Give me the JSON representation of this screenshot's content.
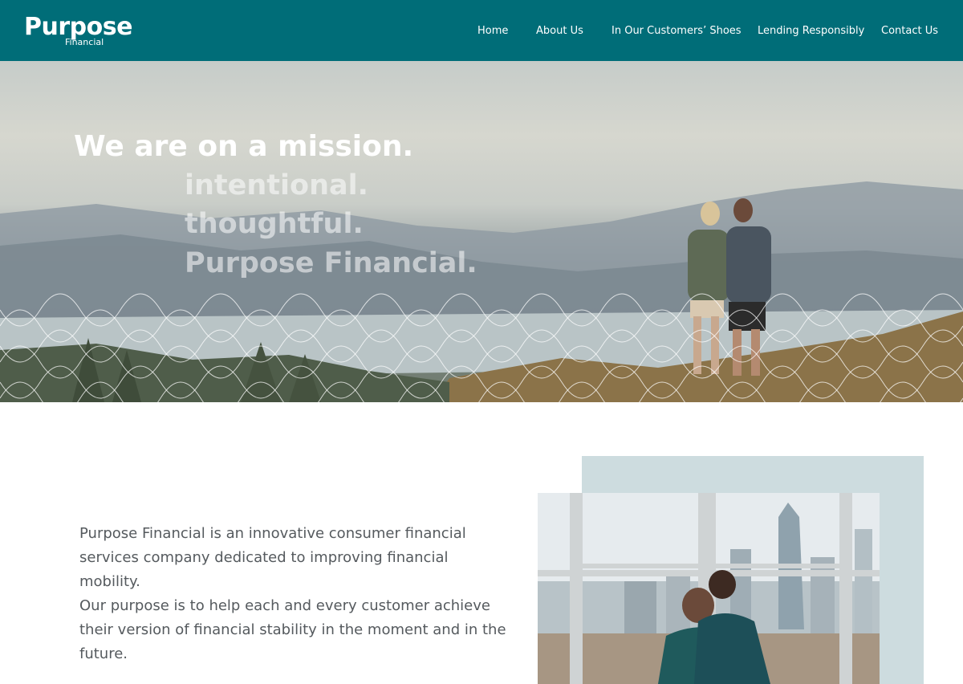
{
  "header": {
    "logo_main": "Purpose",
    "logo_sub": "Financial",
    "nav": [
      {
        "label": "Home"
      },
      {
        "label": "About Us"
      },
      {
        "label": "In Our Customers’ Shoes"
      },
      {
        "label": "Lending Responsibly"
      },
      {
        "label": "Contact Us"
      }
    ]
  },
  "hero": {
    "title": "We are on a mission.",
    "lines": [
      "intentional.",
      "thoughtful.",
      "Purpose Financial."
    ]
  },
  "content": {
    "paragraph_1": "Purpose Financial is an innovative consumer financial services company dedicated to improving financial mobility.",
    "paragraph_2": "Our purpose is to help each and every customer achieve their version of financial stability in the moment and in the future."
  },
  "colors": {
    "header_bg": "#006d78",
    "text": "#555a5e",
    "photo_frame": "#cddcdf"
  }
}
